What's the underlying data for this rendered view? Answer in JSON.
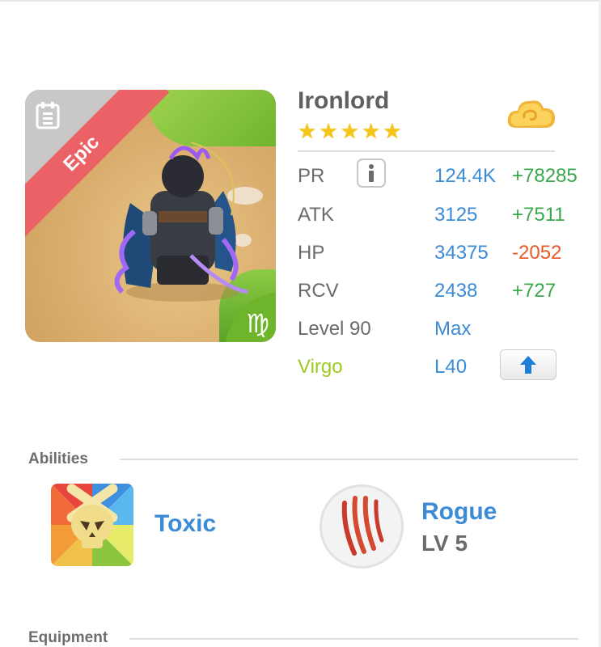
{
  "hero": {
    "name": "Ironlord",
    "rarity": "Epic",
    "stars": 5,
    "zodiac_symbol": "♍",
    "icons": {
      "element": "cloud-icon",
      "rarity": "epic-book-icon"
    }
  },
  "stats": {
    "pr": {
      "label": "PR",
      "value": "124.4K",
      "delta": "+78285"
    },
    "atk": {
      "label": "ATK",
      "value": "3125",
      "delta": "+7511"
    },
    "hp": {
      "label": "HP",
      "value": "34375",
      "delta": "-2052"
    },
    "rcv": {
      "label": "RCV",
      "value": "2438",
      "delta": "+727"
    },
    "level": {
      "label": "Level 90",
      "value": "Max"
    },
    "zodiac": {
      "label": "Virgo",
      "value": "L40"
    }
  },
  "abilities": {
    "title": "Abilities",
    "items": [
      {
        "name": "Toxic",
        "icon": "toxic-skull-icon"
      },
      {
        "name": "Rogue",
        "level": "LV 5",
        "icon": "claw-marks-icon"
      }
    ]
  },
  "equipment": {
    "title": "Equipment"
  },
  "colors": {
    "accent_blue": "#3b8bd6",
    "positive_green": "#3aa84a",
    "negative_orange": "#e85a2a",
    "virgo_green": "#9ecb1f",
    "epic_red": "#ea6166",
    "star_gold": "#f5c518"
  }
}
